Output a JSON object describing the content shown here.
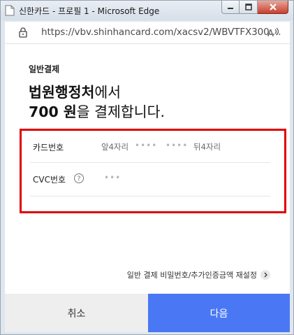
{
  "window": {
    "title": "신한카드 - 프로필 1 - Microsoft Edge"
  },
  "address": {
    "url": "https://vbv.shinhancard.com/xacsv2/WBVTFX300...."
  },
  "payment": {
    "kind": "일반결제",
    "merchant": "법원행정처",
    "merchant_suffix": "에서",
    "amount": "700 원",
    "amount_suffix": "을 결제합니다."
  },
  "form": {
    "card_label": "카드번호",
    "card_first": "앞4자리",
    "card_mid1": "••••",
    "card_mid2": "••••",
    "card_last": "뒤4자리",
    "cvc_label": "CVC번호",
    "cvc_value": "•••"
  },
  "links": {
    "reset": "일반 결제 비밀번호/추가인증금액 재설정"
  },
  "buttons": {
    "cancel": "취소",
    "next": "다음"
  },
  "colors": {
    "accent": "#4a78f5",
    "highlight": "#e00000"
  }
}
